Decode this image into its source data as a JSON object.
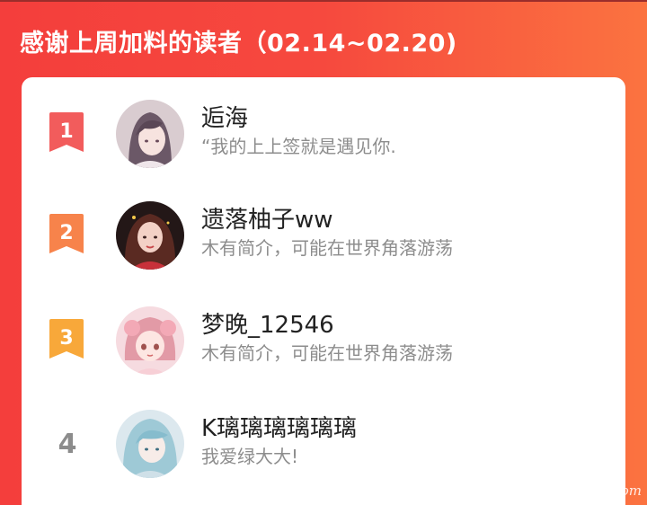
{
  "header": {
    "title": "感谢上周加料的读者（02.14~02.20)"
  },
  "readers": [
    {
      "rank": "1",
      "name": "逅海",
      "desc": "“我的上上签就是遇见你.",
      "badge_color": "#f25c5c"
    },
    {
      "rank": "2",
      "name": "遗落柚子ww",
      "desc": "木有简介，可能在世界角落游荡",
      "badge_color": "#f7834b"
    },
    {
      "rank": "3",
      "name": "梦晚_12546",
      "desc": "木有简介，可能在世界角落游荡",
      "badge_color": "#f8a83a"
    },
    {
      "rank": "4",
      "name": "K璃璃璃璃璃璃",
      "desc": "我爱绿大大!"
    }
  ],
  "watermark": "嗨皮漫画hipmh.com",
  "colors": {
    "header_start": "#f43e3c",
    "header_end": "#fb7340",
    "name_text": "#222222",
    "desc_text": "#8d8d8d"
  }
}
